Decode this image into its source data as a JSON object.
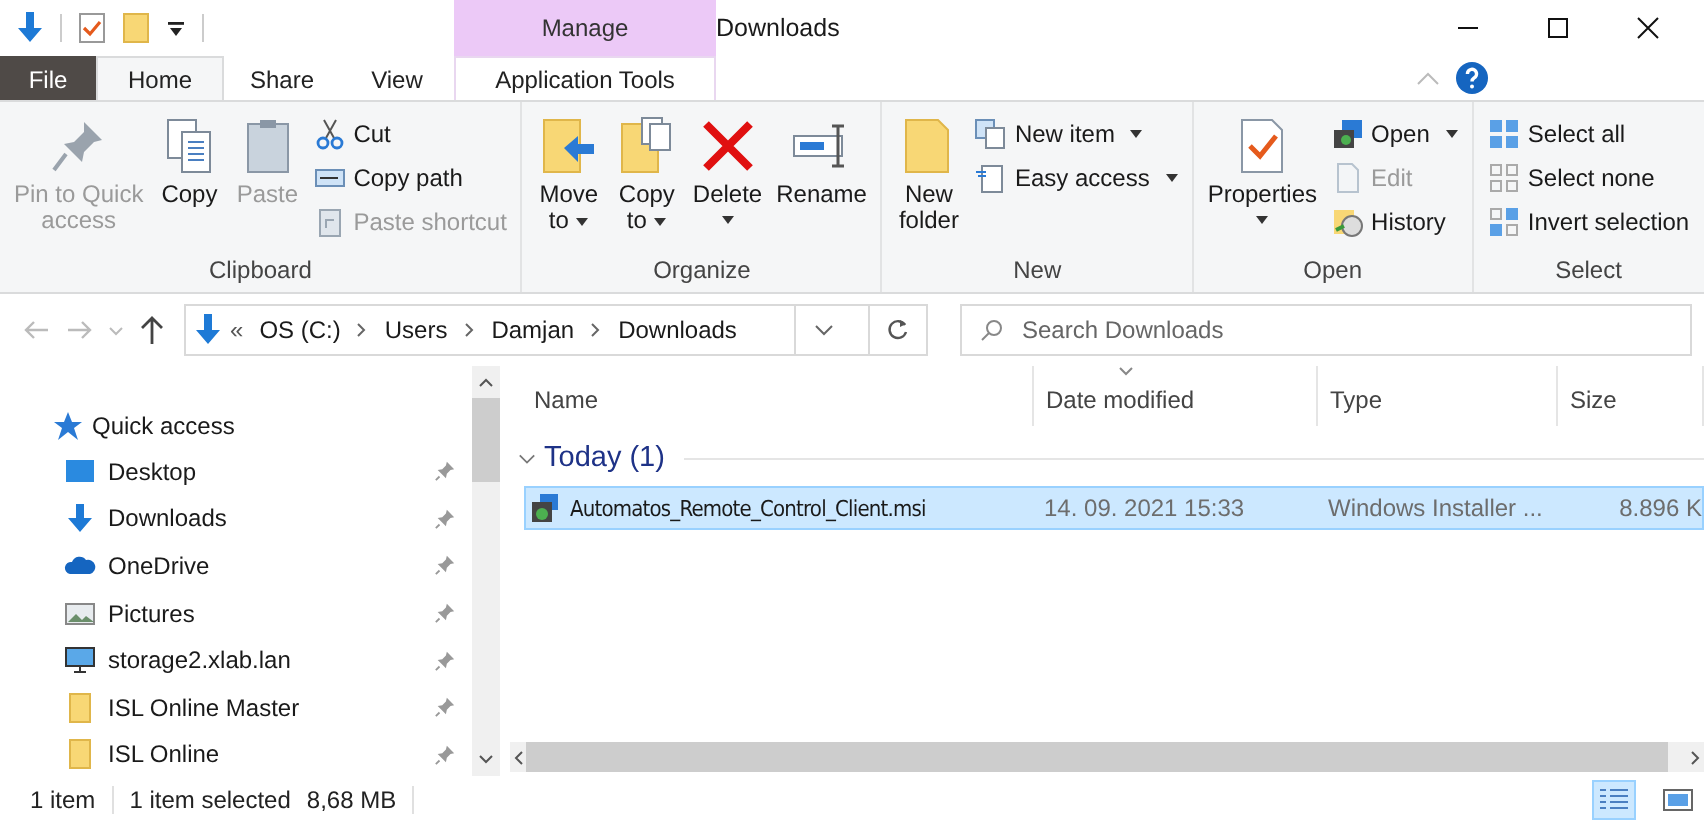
{
  "title_bar": {
    "context_group": "Manage",
    "title": "Downloads"
  },
  "tabs": [
    {
      "label": "File",
      "kind": "file",
      "selected": false
    },
    {
      "label": "Home",
      "kind": "plain",
      "selected": true
    },
    {
      "label": "Share",
      "kind": "plain",
      "selected": false
    },
    {
      "label": "View",
      "kind": "plain",
      "selected": false
    },
    {
      "label": "Application Tools",
      "kind": "context",
      "selected": false
    }
  ],
  "ribbon": {
    "groups": [
      {
        "name": "Clipboard",
        "commands": [
          {
            "kind": "large",
            "lines": [
              "Pin to Quick",
              "access"
            ],
            "disabled": true,
            "dropdown": false
          },
          {
            "kind": "large",
            "lines": [
              "Copy"
            ],
            "disabled": false,
            "dropdown": false
          },
          {
            "kind": "large",
            "lines": [
              "Paste"
            ],
            "disabled": true,
            "dropdown": false
          },
          {
            "kind": "small",
            "lines": [
              "Cut"
            ],
            "disabled": false,
            "dropdown": false
          },
          {
            "kind": "small",
            "lines": [
              "Copy path"
            ],
            "disabled": false,
            "dropdown": false
          },
          {
            "kind": "small",
            "lines": [
              "Paste shortcut"
            ],
            "disabled": true,
            "dropdown": false
          }
        ]
      },
      {
        "name": "Organize",
        "commands": [
          {
            "kind": "large",
            "lines": [
              "Move",
              "to"
            ],
            "disabled": false,
            "dropdown": true
          },
          {
            "kind": "large",
            "lines": [
              "Copy",
              "to"
            ],
            "disabled": false,
            "dropdown": true
          },
          {
            "kind": "large",
            "lines": [
              "Delete"
            ],
            "disabled": false,
            "dropdown": true
          },
          {
            "kind": "large",
            "lines": [
              "Rename"
            ],
            "disabled": false,
            "dropdown": false
          }
        ]
      },
      {
        "name": "New",
        "commands": [
          {
            "kind": "large",
            "lines": [
              "New",
              "folder"
            ],
            "disabled": false,
            "dropdown": false
          },
          {
            "kind": "small",
            "lines": [
              "New item"
            ],
            "disabled": false,
            "dropdown": true
          },
          {
            "kind": "small",
            "lines": [
              "Easy access"
            ],
            "disabled": false,
            "dropdown": true
          }
        ]
      },
      {
        "name": "Open",
        "commands": [
          {
            "kind": "large",
            "lines": [
              "Properties"
            ],
            "disabled": false,
            "dropdown": true
          },
          {
            "kind": "small",
            "lines": [
              "Open"
            ],
            "disabled": false,
            "dropdown": true
          },
          {
            "kind": "small",
            "lines": [
              "Edit"
            ],
            "disabled": true,
            "dropdown": false
          },
          {
            "kind": "small",
            "lines": [
              "History"
            ],
            "disabled": false,
            "dropdown": false
          }
        ]
      },
      {
        "name": "Select",
        "commands": [
          {
            "kind": "small",
            "lines": [
              "Select all"
            ],
            "disabled": false,
            "dropdown": false
          },
          {
            "kind": "small",
            "lines": [
              "Select none"
            ],
            "disabled": false,
            "dropdown": false
          },
          {
            "kind": "small",
            "lines": [
              "Invert selection"
            ],
            "disabled": false,
            "dropdown": false
          }
        ]
      }
    ]
  },
  "address_bar": {
    "overflow": "«",
    "path": [
      "OS (C:)",
      "Users",
      "Damjan",
      "Downloads"
    ]
  },
  "search": {
    "placeholder": "Search Downloads"
  },
  "sidebar": {
    "header": "Quick access",
    "items": [
      {
        "label": "Desktop",
        "pinned": true
      },
      {
        "label": "Downloads",
        "pinned": true
      },
      {
        "label": "OneDrive",
        "pinned": true
      },
      {
        "label": "Pictures",
        "pinned": true
      },
      {
        "label": "storage2.xlab.lan",
        "pinned": true
      },
      {
        "label": "ISL Online Master",
        "pinned": true
      },
      {
        "label": "ISL Online",
        "pinned": true
      }
    ]
  },
  "table": {
    "columns": [
      {
        "label": "Name",
        "sorted": false
      },
      {
        "label": "Date modified",
        "sorted": true
      },
      {
        "label": "Type",
        "sorted": false
      },
      {
        "label": "Size",
        "sorted": false
      }
    ],
    "groups": [
      {
        "label": "Today (1)",
        "expanded": true,
        "rows": [
          {
            "name": "Automatos_Remote_Control_Client.msi",
            "date": "14. 09. 2021 15:33",
            "type": "Windows Installer ...",
            "size": "8.896 K",
            "selected": true
          }
        ]
      }
    ]
  },
  "status_bar": {
    "count": "1 item",
    "selection": "1 item selected",
    "size": "8,68 MB",
    "views": [
      {
        "kind": "details",
        "selected": true
      },
      {
        "kind": "large_icons",
        "selected": false
      }
    ]
  }
}
